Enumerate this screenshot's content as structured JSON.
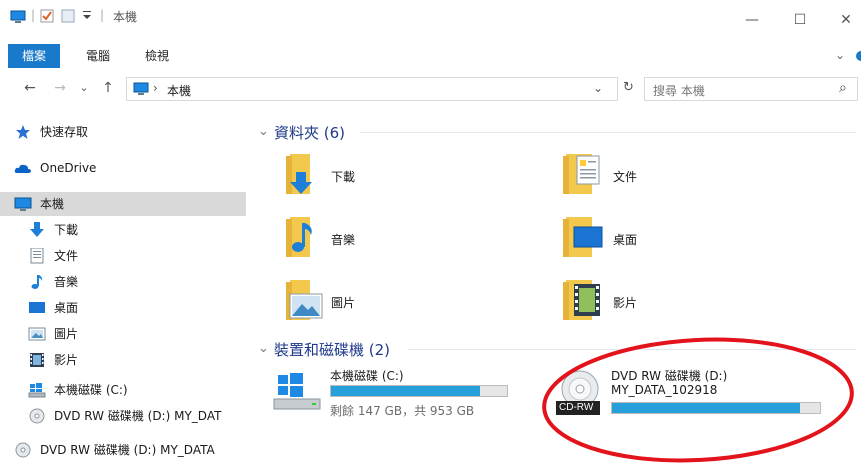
{
  "window": {
    "title": "本機",
    "title_separator": "|",
    "minimize": "—",
    "maximize": "☐",
    "close": "✕"
  },
  "ribbon": {
    "tabs": [
      "檔案",
      "電腦",
      "檢視"
    ],
    "expand_glyph": "⌄"
  },
  "address": {
    "back": "←",
    "forward": "→",
    "recent": "⌄",
    "up": "↑",
    "separator": "›",
    "path": "本機",
    "dropdown": "⌄",
    "refresh": "↻",
    "search_placeholder": "搜尋 本機",
    "search_glyph": "⌕"
  },
  "sidebar": {
    "items": [
      {
        "label": "快速存取",
        "icon": "star-icon"
      },
      {
        "label": "OneDrive",
        "icon": "cloud-icon"
      },
      {
        "label": "本機",
        "icon": "computer-icon",
        "selected": true
      },
      {
        "label": "下載",
        "icon": "download-arrow-icon"
      },
      {
        "label": "文件",
        "icon": "document-icon"
      },
      {
        "label": "音樂",
        "icon": "music-note-icon"
      },
      {
        "label": "桌面",
        "icon": "desktop-icon"
      },
      {
        "label": "圖片",
        "icon": "picture-icon"
      },
      {
        "label": "影片",
        "icon": "film-icon"
      },
      {
        "label": "本機磁碟 (C:)",
        "icon": "windows-drive-icon"
      },
      {
        "label": "DVD RW 磁碟機 (D:) MY_DAT",
        "icon": "dvd-disc-icon"
      },
      {
        "label": "DVD RW 磁碟機 (D:) MY_DATA",
        "icon": "dvd-disc-icon"
      }
    ]
  },
  "content": {
    "folders_group": {
      "title": "資料夾 (6)",
      "chevron": "⌄",
      "items": [
        {
          "label": "下載",
          "icon": "downloads-folder-icon"
        },
        {
          "label": "文件",
          "icon": "documents-folder-icon"
        },
        {
          "label": "音樂",
          "icon": "music-folder-icon"
        },
        {
          "label": "桌面",
          "icon": "desktop-folder-icon"
        },
        {
          "label": "圖片",
          "icon": "pictures-folder-icon"
        },
        {
          "label": "影片",
          "icon": "videos-folder-icon"
        }
      ]
    },
    "devices_group": {
      "title": "裝置和磁碟機 (2)",
      "chevron": "⌄",
      "drives": [
        {
          "name": "本機磁碟 (C:)",
          "free_text": "剩餘 147 GB，共 953 GB",
          "used_fraction": 0.846,
          "icon": "windows-drive-icon"
        },
        {
          "name": "DVD RW 磁碟機 (D:)",
          "volume": "MY_DATA_102918",
          "badge": "CD-RW",
          "used_fraction": 0.905,
          "icon": "cd-rw-disc-icon"
        }
      ]
    }
  },
  "colors": {
    "accent": "#1979ca",
    "usage_bar": "#26a0da",
    "annotation_ellipse": "#e3131b",
    "selection": "#d9d9d9"
  }
}
